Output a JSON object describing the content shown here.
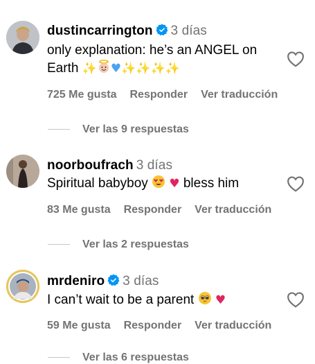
{
  "comments": [
    {
      "username": "dustincarrington",
      "verified": true,
      "time": "3 días",
      "text": "only explanation: he’s an ANGEL on Earth",
      "emojis": [
        "sparkles",
        "angel",
        "blue-heart",
        "sparkles",
        "sparkles",
        "sparkles",
        "sparkles"
      ],
      "likes": "725 Me gusta",
      "reply": "Responder",
      "translate": "Ver traducción",
      "view_replies": "Ver las 9 respuestas"
    },
    {
      "username": "noorboufrach",
      "verified": false,
      "time": "3 días",
      "text": "Spiritual babyboy",
      "text_after": "bless him",
      "emojis": [
        "heart-eyes",
        "red-heart"
      ],
      "likes": "83 Me gusta",
      "reply": "Responder",
      "translate": "Ver traducción",
      "view_replies": "Ver las 2 respuestas"
    },
    {
      "username": "mrdeniro",
      "verified": true,
      "time": "3 días",
      "text": "I can’t wait to be a parent",
      "emojis": [
        "pleading-face",
        "red-heart"
      ],
      "likes": "59 Me gusta",
      "reply": "Responder",
      "translate": "Ver traducción",
      "view_replies": "Ver las 6 respuestas"
    }
  ],
  "colors": {
    "secondary_text": "#737373",
    "verified_blue": "#0095f6",
    "divider": "#c7c7c7"
  }
}
